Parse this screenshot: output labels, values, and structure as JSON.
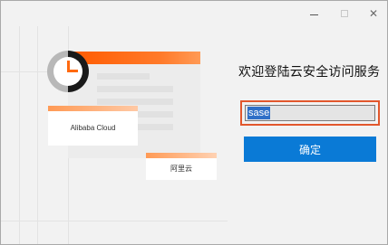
{
  "window": {
    "controls": {
      "minimize_icon": "minimize-icon",
      "maximize_icon": "maximize-icon",
      "close_label": "✕"
    }
  },
  "illustration": {
    "tile_1_label": "Alibaba Cloud",
    "tile_2_label": "阿里云",
    "accent_color": "#ff5a00"
  },
  "login": {
    "title": "欢迎登陆云安全访问服务",
    "input_value": "sase",
    "confirm_label": "确定",
    "button_color": "#0a7ad6",
    "highlight_color": "#e2572c"
  }
}
